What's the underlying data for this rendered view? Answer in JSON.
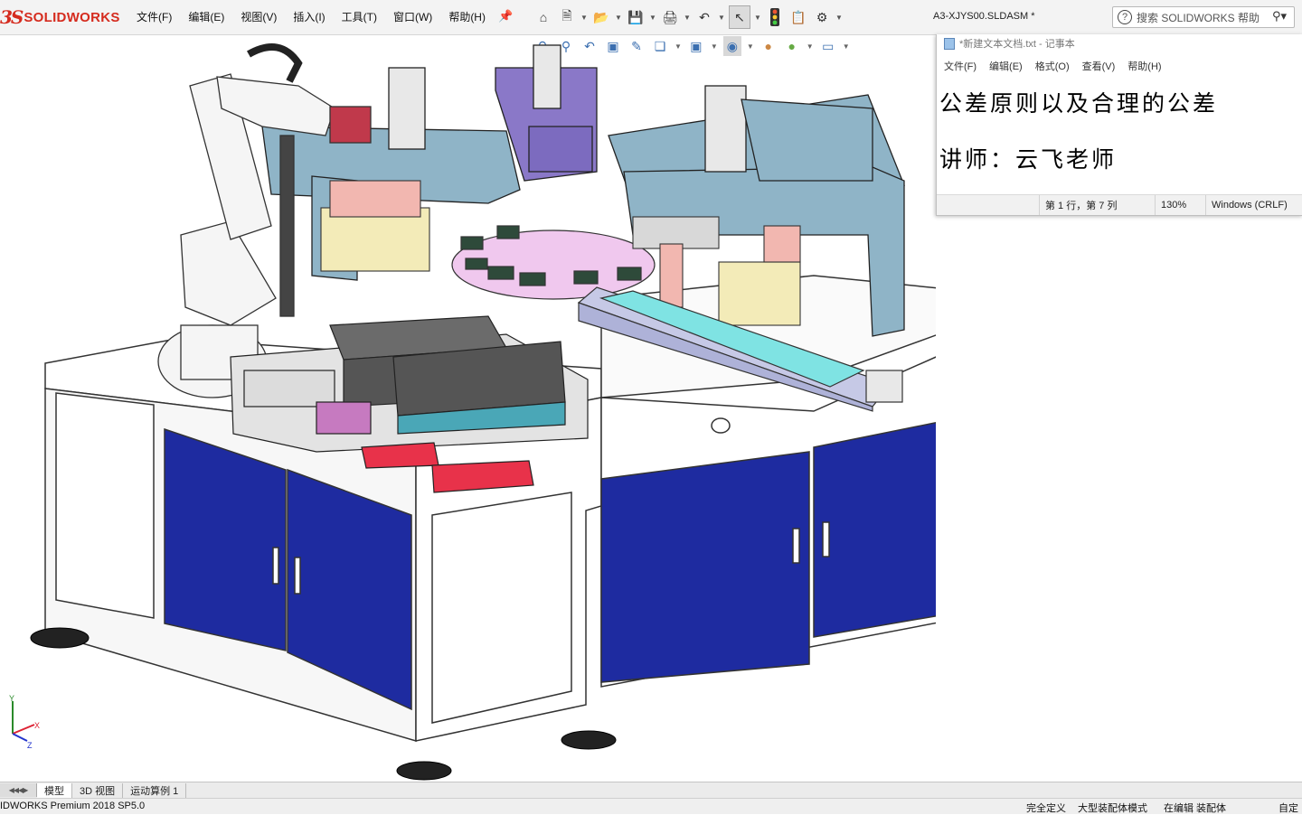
{
  "app": {
    "logo_prefix": "3S",
    "logo_text": "SOLIDWORKS"
  },
  "menu": [
    "文件(F)",
    "编辑(E)",
    "视图(V)",
    "插入(I)",
    "工具(T)",
    "窗口(W)",
    "帮助(H)"
  ],
  "document_title": "A3-XJYS00.SLDASM *",
  "search": {
    "placeholder": "搜索 SOLIDWORKS 帮助"
  },
  "notepad": {
    "title": "*新建文本文档.txt - 记事本",
    "menu": [
      "文件(F)",
      "编辑(E)",
      "格式(O)",
      "查看(V)",
      "帮助(H)"
    ],
    "lines": [
      "公差原则以及合理的公差",
      "讲师：云飞老师"
    ],
    "status": {
      "position": "第 1 行，第 7 列",
      "zoom": "130%",
      "encoding": "Windows (CRLF)"
    }
  },
  "tabs": [
    "模型",
    "3D 视图",
    "运动算例 1"
  ],
  "active_tab": "模型",
  "status": {
    "version": "IDWORKS Premium 2018 SP5.0",
    "definition": "完全定义",
    "mode": "大型装配体模式",
    "editing": "在编辑 装配体",
    "custom": "自定"
  },
  "colors": {
    "cabinet_door": "#1e2ba0",
    "machine_frame": "#8fb4c7",
    "turntable": "#f0c8ee",
    "conveyor_belt": "#7fe3e3",
    "bracket_purple": "#8a78c8",
    "red_base": "#e8324a",
    "logo_red": "#d52b1e"
  },
  "icons": [
    "home-icon",
    "new-document-icon",
    "open-icon",
    "save-icon",
    "print-icon",
    "undo-icon",
    "select-icon",
    "traffic-light-icon",
    "options-icon",
    "file-properties-icon",
    "settings-gear-icon"
  ]
}
